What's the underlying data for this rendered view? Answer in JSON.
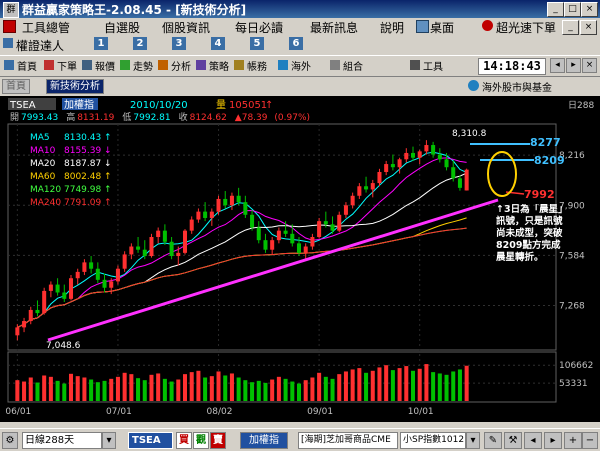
{
  "window": {
    "title": "群益贏家策略王-2.08.45 - [新技術分析]",
    "app_icon_text": "群"
  },
  "menu": {
    "items": [
      "工具總管",
      "自選股",
      "個股資訊",
      "每日必讀",
      "最新訊息",
      "說明",
      "桌面",
      "超光速下單"
    ]
  },
  "row2": {
    "label": "權證達人",
    "numbers": [
      "1",
      "2",
      "3",
      "4",
      "5",
      "6"
    ]
  },
  "toolbar": {
    "items": [
      "首頁",
      "下單",
      "報價",
      "走勢",
      "分析",
      "策略",
      "帳務",
      "海外",
      "組合",
      "工具"
    ],
    "time": "14:18:43"
  },
  "tabs": {
    "home": "首頁",
    "active": "新技術分析",
    "overseas": "海外股市與基金"
  },
  "chart_data": {
    "type": "candlestick",
    "symbol": "TSEA",
    "mode": "加權指",
    "date": "2010/10/20",
    "volume_label": "量",
    "volume": "105051",
    "volume_arrow": "↑",
    "header_values": [
      {
        "label": "開",
        "value": "7993.43",
        "color": "#00ffff"
      },
      {
        "label": "高",
        "value": "8131.19",
        "color": "#ff3030"
      },
      {
        "label": "低",
        "value": "7992.81",
        "color": "#00ffff"
      },
      {
        "label": "收",
        "value": "8124.62",
        "color": "#ff3030"
      },
      {
        "label": "",
        "value": "▲78.39",
        "color": "#ff3030"
      },
      {
        "label": "",
        "value": "(0.97%)",
        "color": "#ff3030"
      }
    ],
    "day_range": "日288",
    "ma_legend": [
      {
        "name": "MA5",
        "value": "8130.43",
        "arrow": "↑",
        "color": "#00ffff"
      },
      {
        "name": "MA10",
        "value": "8155.39",
        "arrow": "↓",
        "color": "#ff00ff"
      },
      {
        "name": "MA20",
        "value": "8187.87",
        "arrow": "↓",
        "color": "#ffffff"
      },
      {
        "name": "MA60",
        "value": "8002.48",
        "arrow": "↑",
        "color": "#ffd000"
      },
      {
        "name": "MA120",
        "value": "7749.98",
        "arrow": "↑",
        "color": "#40ff40"
      },
      {
        "name": "MA240",
        "value": "7791.09",
        "arrow": "↑",
        "color": "#ff3030"
      }
    ],
    "y_ticks": [
      "8,216",
      "7,900",
      "7,584",
      "7,268"
    ],
    "y_ticks_values": [
      8216,
      7900,
      7584,
      7268
    ],
    "y_range": [
      7000,
      8400
    ],
    "volume_ticks": [
      "106662",
      "53331"
    ],
    "volume_ticks_values": [
      106662,
      53331
    ],
    "volume_range": [
      0,
      140000
    ],
    "x_labels": [
      "06/01",
      "07/01",
      "08/02",
      "09/01",
      "10/01"
    ],
    "annotations": {
      "high": "8,310.8",
      "low": "7,048.6",
      "level_8277": "8277",
      "level_8209": "8209",
      "level_7992": "7992",
      "note": "↑3日為「晨星」訊號，只是訊號尚未成型，突破8209點方完成晨星轉折。"
    },
    "candles": [
      {
        "o": 7080,
        "h": 7150,
        "l": 7048.6,
        "c": 7130
      },
      {
        "o": 7130,
        "h": 7190,
        "l": 7100,
        "c": 7170
      },
      {
        "o": 7170,
        "h": 7260,
        "l": 7150,
        "c": 7240
      },
      {
        "o": 7240,
        "h": 7300,
        "l": 7200,
        "c": 7220
      },
      {
        "o": 7220,
        "h": 7380,
        "l": 7210,
        "c": 7360
      },
      {
        "o": 7360,
        "h": 7420,
        "l": 7320,
        "c": 7400
      },
      {
        "o": 7400,
        "h": 7440,
        "l": 7330,
        "c": 7350
      },
      {
        "o": 7350,
        "h": 7400,
        "l": 7290,
        "c": 7310
      },
      {
        "o": 7310,
        "h": 7460,
        "l": 7300,
        "c": 7440
      },
      {
        "o": 7440,
        "h": 7500,
        "l": 7400,
        "c": 7480
      },
      {
        "o": 7480,
        "h": 7560,
        "l": 7460,
        "c": 7540
      },
      {
        "o": 7540,
        "h": 7580,
        "l": 7470,
        "c": 7500
      },
      {
        "o": 7500,
        "h": 7540,
        "l": 7410,
        "c": 7430
      },
      {
        "o": 7430,
        "h": 7470,
        "l": 7350,
        "c": 7380
      },
      {
        "o": 7380,
        "h": 7440,
        "l": 7340,
        "c": 7420
      },
      {
        "o": 7420,
        "h": 7520,
        "l": 7400,
        "c": 7500
      },
      {
        "o": 7500,
        "h": 7610,
        "l": 7480,
        "c": 7590
      },
      {
        "o": 7590,
        "h": 7660,
        "l": 7560,
        "c": 7640
      },
      {
        "o": 7640,
        "h": 7700,
        "l": 7600,
        "c": 7620
      },
      {
        "o": 7620,
        "h": 7680,
        "l": 7560,
        "c": 7580
      },
      {
        "o": 7580,
        "h": 7720,
        "l": 7570,
        "c": 7700
      },
      {
        "o": 7700,
        "h": 7760,
        "l": 7660,
        "c": 7740
      },
      {
        "o": 7740,
        "h": 7780,
        "l": 7650,
        "c": 7670
      },
      {
        "o": 7670,
        "h": 7700,
        "l": 7560,
        "c": 7580
      },
      {
        "o": 7580,
        "h": 7640,
        "l": 7520,
        "c": 7600
      },
      {
        "o": 7600,
        "h": 7750,
        "l": 7590,
        "c": 7740
      },
      {
        "o": 7740,
        "h": 7830,
        "l": 7720,
        "c": 7810
      },
      {
        "o": 7810,
        "h": 7880,
        "l": 7790,
        "c": 7860
      },
      {
        "o": 7860,
        "h": 7920,
        "l": 7800,
        "c": 7820
      },
      {
        "o": 7820,
        "h": 7880,
        "l": 7770,
        "c": 7860
      },
      {
        "o": 7860,
        "h": 7960,
        "l": 7840,
        "c": 7940
      },
      {
        "o": 7940,
        "h": 7990,
        "l": 7880,
        "c": 7900
      },
      {
        "o": 7900,
        "h": 7980,
        "l": 7870,
        "c": 7960
      },
      {
        "o": 7960,
        "h": 8010,
        "l": 7900,
        "c": 7920
      },
      {
        "o": 7920,
        "h": 7960,
        "l": 7820,
        "c": 7840
      },
      {
        "o": 7840,
        "h": 7870,
        "l": 7740,
        "c": 7760
      },
      {
        "o": 7760,
        "h": 7800,
        "l": 7660,
        "c": 7680
      },
      {
        "o": 7680,
        "h": 7720,
        "l": 7600,
        "c": 7620
      },
      {
        "o": 7620,
        "h": 7700,
        "l": 7590,
        "c": 7680
      },
      {
        "o": 7680,
        "h": 7760,
        "l": 7660,
        "c": 7740
      },
      {
        "o": 7740,
        "h": 7800,
        "l": 7700,
        "c": 7720
      },
      {
        "o": 7720,
        "h": 7780,
        "l": 7640,
        "c": 7660
      },
      {
        "o": 7660,
        "h": 7700,
        "l": 7580,
        "c": 7600
      },
      {
        "o": 7600,
        "h": 7660,
        "l": 7560,
        "c": 7640
      },
      {
        "o": 7640,
        "h": 7720,
        "l": 7620,
        "c": 7700
      },
      {
        "o": 7700,
        "h": 7820,
        "l": 7690,
        "c": 7800
      },
      {
        "o": 7800,
        "h": 7860,
        "l": 7760,
        "c": 7780
      },
      {
        "o": 7780,
        "h": 7830,
        "l": 7720,
        "c": 7740
      },
      {
        "o": 7740,
        "h": 7860,
        "l": 7730,
        "c": 7840
      },
      {
        "o": 7840,
        "h": 7920,
        "l": 7820,
        "c": 7900
      },
      {
        "o": 7900,
        "h": 7980,
        "l": 7880,
        "c": 7960
      },
      {
        "o": 7960,
        "h": 8040,
        "l": 7940,
        "c": 8020
      },
      {
        "o": 8020,
        "h": 8080,
        "l": 7980,
        "c": 8000
      },
      {
        "o": 8000,
        "h": 8060,
        "l": 7950,
        "c": 8040
      },
      {
        "o": 8040,
        "h": 8130,
        "l": 8020,
        "c": 8110
      },
      {
        "o": 8110,
        "h": 8180,
        "l": 8090,
        "c": 8160
      },
      {
        "o": 8160,
        "h": 8220,
        "l": 8120,
        "c": 8140
      },
      {
        "o": 8140,
        "h": 8200,
        "l": 8100,
        "c": 8190
      },
      {
        "o": 8190,
        "h": 8260,
        "l": 8170,
        "c": 8230
      },
      {
        "o": 8230,
        "h": 8270,
        "l": 8180,
        "c": 8200
      },
      {
        "o": 8200,
        "h": 8250,
        "l": 8160,
        "c": 8240
      },
      {
        "o": 8240,
        "h": 8310.8,
        "l": 8220,
        "c": 8280
      },
      {
        "o": 8280,
        "h": 8300,
        "l": 8200,
        "c": 8220
      },
      {
        "o": 8220,
        "h": 8260,
        "l": 8170,
        "c": 8190
      },
      {
        "o": 8190,
        "h": 8230,
        "l": 8120,
        "c": 8140
      },
      {
        "o": 8140,
        "h": 8180,
        "l": 8050,
        "c": 8070
      },
      {
        "o": 8070,
        "h": 8090,
        "l": 7992,
        "c": 8010
      },
      {
        "o": 7993.43,
        "h": 8131.19,
        "l": 7992.81,
        "c": 8124.62
      }
    ],
    "volumes": [
      62000,
      58000,
      70000,
      55000,
      76000,
      72000,
      60000,
      52000,
      81000,
      74000,
      70000,
      64000,
      56000,
      60000,
      66000,
      72000,
      84000,
      80000,
      68000,
      62000,
      78000,
      82000,
      66000,
      58000,
      64000,
      80000,
      86000,
      90000,
      70000,
      74000,
      88000,
      76000,
      82000,
      70000,
      62000,
      56000,
      60000,
      54000,
      64000,
      72000,
      66000,
      58000,
      52000,
      62000,
      70000,
      84000,
      72000,
      66000,
      80000,
      88000,
      94000,
      98000,
      84000,
      90000,
      100000,
      106662,
      92000,
      98000,
      104000,
      90000,
      96000,
      110000,
      86000,
      82000,
      78000,
      88000,
      94000,
      105051
    ],
    "volume_colors": "up-red-down-green"
  },
  "bottom": {
    "days_select": "日線288天",
    "symbol": "TSEA",
    "buy": "買",
    "watch": "觀",
    "sell": "賣",
    "index": "加權指",
    "foreign": "[海期]芝加哥商品CME",
    "sp": "小SP指數1012"
  }
}
